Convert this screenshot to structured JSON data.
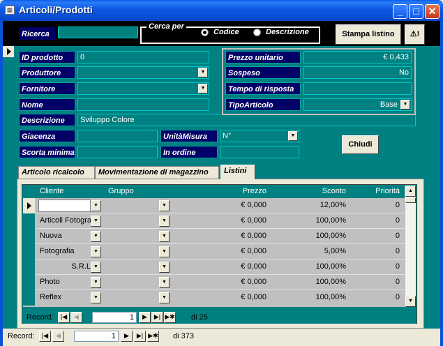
{
  "window": {
    "title": "Articoli/Prodotti",
    "icon": "table-icon"
  },
  "search": {
    "label": "Ricerca",
    "value": "",
    "group_label": "Cerca per",
    "opt_code": "Codice",
    "opt_desc": "Descrizione",
    "selected": "Codice"
  },
  "toolbar": {
    "print_label": "Stampa listino",
    "excl_label": "⚠!"
  },
  "fields": {
    "id_label": "ID prodotto",
    "id_value": "0",
    "prod_label": "Produttore",
    "prod_value": "",
    "forn_label": "Fornitore",
    "forn_value": "",
    "nome_label": "Nome",
    "nome_value": "",
    "desc_label": "Descrizione",
    "desc_value": "Sviluppo Colore",
    "giac_label": "Giacenza",
    "giac_value": "",
    "unita_label": "UnitàMisura",
    "unita_value": "N°",
    "scorta_label": "Scorta minima",
    "scorta_value": "",
    "ordine_label": "In ordine",
    "ordine_value": "",
    "prezzo_label": "Prezzo unitario",
    "prezzo_value": "€ 0,433",
    "sospeso_label": "Sospeso",
    "sospeso_value": "No",
    "tempo_label": "Tempo di risposta",
    "tempo_value": "",
    "tipo_label": "TipoArticolo",
    "tipo_value": "Base"
  },
  "close_label": "Chiudi",
  "tabs": [
    {
      "label": "Articolo ricalcolo"
    },
    {
      "label": "Movimentazione di magazzino"
    },
    {
      "label": "Listini"
    }
  ],
  "grid": {
    "columns": [
      "Cliente",
      "Gruppo",
      "Prezzo",
      "Sconto",
      "Priorità"
    ],
    "rows": [
      {
        "cliente": "",
        "prezzo": "€ 0,000",
        "sconto": "12,00%",
        "priorita": "0"
      },
      {
        "cliente": "Articoli Fotografici",
        "prezzo": "€ 0,000",
        "sconto": "100,00%",
        "priorita": "0"
      },
      {
        "cliente": "Nuova",
        "prezzo": "€ 0,000",
        "sconto": "100,00%",
        "priorita": "0"
      },
      {
        "cliente": "Fotografia",
        "prezzo": "€ 0,000",
        "sconto": "5,00%",
        "priorita": "0"
      },
      {
        "cliente": "S.R.L",
        "prezzo": "€ 0,000",
        "sconto": "100,00%",
        "priorita": "0"
      },
      {
        "cliente": "Photo",
        "prezzo": "€ 0,000",
        "sconto": "100,00%",
        "priorita": "0"
      },
      {
        "cliente": "Reflex",
        "prezzo": "€ 0,000",
        "sconto": "100,00%",
        "priorita": "0"
      }
    ]
  },
  "subnav": {
    "label": "Record:",
    "current": "1",
    "total": "di 25"
  },
  "mainnav": {
    "label": "Record:",
    "current": "1",
    "total": "di 373"
  }
}
